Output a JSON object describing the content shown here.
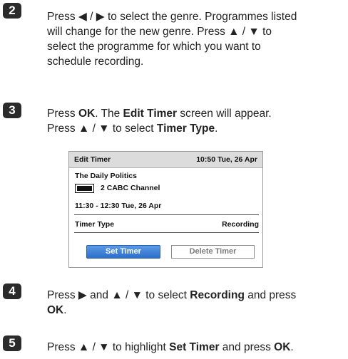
{
  "steps": [
    {
      "number": "2",
      "lines": [
        "Press ◀ / ▶ to select the genre. Programmes listed",
        "will change for the new genre. Press ▲ / ▼ to",
        "select the programme for which you want to",
        "schedule recording."
      ]
    },
    {
      "number": "3",
      "line1": {
        "a": "Press ",
        "b": "OK",
        "c": ". The ",
        "d": "Edit Timer",
        "e": " screen will appear."
      },
      "line2": {
        "a": "Press ▲ / ▼ to select ",
        "b": "Timer Type",
        "c": "."
      }
    },
    {
      "number": "4",
      "line1": {
        "a": "Press ▶ and ▲ / ▼ to select ",
        "b": "Recording",
        "c": " and press"
      },
      "line2": {
        "a": "OK",
        "b": "."
      }
    },
    {
      "number": "5",
      "line1": {
        "a": "Press ▲ / ▼ to highlight ",
        "b": "Set Timer",
        "c": " and press ",
        "d": "OK",
        "e": "."
      }
    }
  ],
  "edit_timer": {
    "title": "Edit Timer",
    "datetime": "10:50 Tue, 26 Apr",
    "programme": "The Daily Politics",
    "channel": "2  CABC  Channel",
    "time_range": "11:30 - 12:30 Tue, 26 Apr",
    "timer_type_label": "Timer Type",
    "timer_type_value": "Recording",
    "set_button": "Set Timer",
    "delete_button": "Delete Timer"
  }
}
